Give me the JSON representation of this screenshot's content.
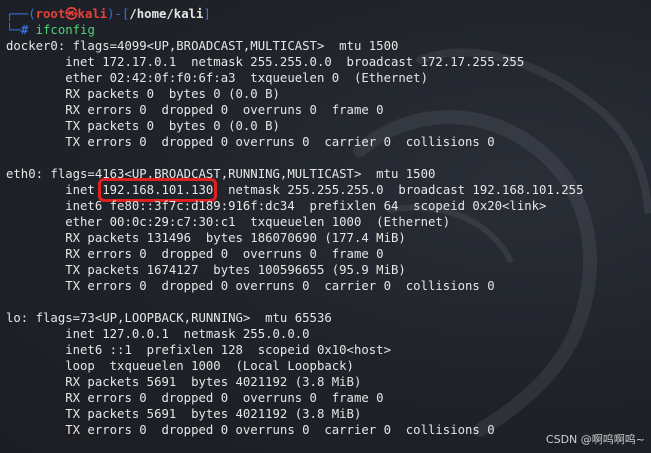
{
  "prompt": {
    "line1_prefix": "┌──(",
    "user": "root㉿kali",
    "line1_mid": ")-[",
    "path": "/home/kali",
    "line1_suffix": "]",
    "line2_prefix": "└─",
    "hash": "#",
    "command": "ifconfig"
  },
  "output": {
    "l01": "docker0: flags=4099<UP,BROADCAST,MULTICAST>  mtu 1500",
    "l02": "        inet 172.17.0.1  netmask 255.255.0.0  broadcast 172.17.255.255",
    "l03": "        ether 02:42:0f:f0:6f:a3  txqueuelen 0  (Ethernet)",
    "l04": "        RX packets 0  bytes 0 (0.0 B)",
    "l05": "        RX errors 0  dropped 0  overruns 0  frame 0",
    "l06": "        TX packets 0  bytes 0 (0.0 B)",
    "l07": "        TX errors 0  dropped 0 overruns 0  carrier 0  collisions 0",
    "l08": "",
    "l09": "eth0: flags=4163<UP,BROADCAST,RUNNING,MULTICAST>  mtu 1500",
    "l10_prefix": "        inet ",
    "l10_ip": "192.168.101.130",
    "l10_suffix": "  netmask 255.255.255.0  broadcast 192.168.101.255",
    "l11": "        inet6 fe80::3f7c:d189:916f:dc34  prefixlen 64  scopeid 0x20<link>",
    "l12": "        ether 00:0c:29:c7:30:c1  txqueuelen 1000  (Ethernet)",
    "l13": "        RX packets 131496  bytes 186070690 (177.4 MiB)",
    "l14": "        RX errors 0  dropped 0  overruns 0  frame 0",
    "l15": "        TX packets 1674127  bytes 100596655 (95.9 MiB)",
    "l16": "        TX errors 0  dropped 0 overruns 0  carrier 0  collisions 0",
    "l17": "",
    "l18": "lo: flags=73<UP,LOOPBACK,RUNNING>  mtu 65536",
    "l19": "        inet 127.0.0.1  netmask 255.0.0.0",
    "l20": "        inet6 ::1  prefixlen 128  scopeid 0x10<host>",
    "l21": "        loop  txqueuelen 1000  (Local Loopback)",
    "l22": "        RX packets 5691  bytes 4021192 (3.8 MiB)",
    "l23": "        RX errors 0  dropped 0  overruns 0  frame 0",
    "l24": "        TX packets 5691  bytes 4021192 (3.8 MiB)",
    "l25": "        TX errors 0  dropped 0 overruns 0  carrier 0  collisions 0"
  },
  "watermark": "CSDN @啊呜啊呜~",
  "colors": {
    "background": "#1f2229",
    "prompt_frame": "#3b6fe0",
    "prompt_user": "#e8413a",
    "command": "#4fd37a",
    "highlight_box": "#e02020"
  },
  "icons": {
    "background": "kali-dragon-logo"
  }
}
